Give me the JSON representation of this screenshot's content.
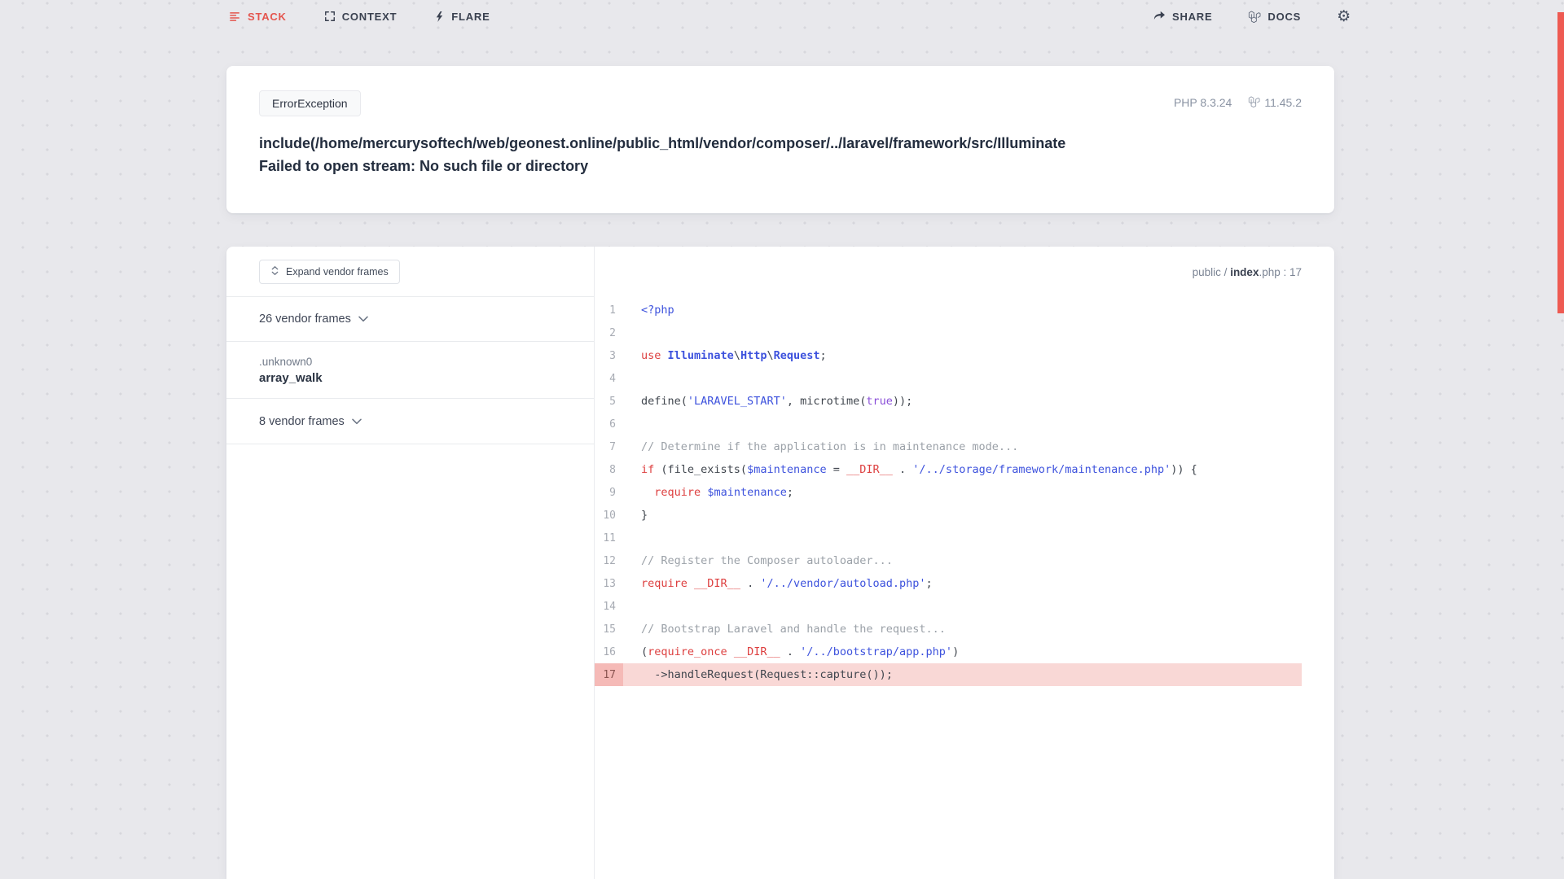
{
  "nav": {
    "tabs": [
      {
        "label": "STACK",
        "active": true
      },
      {
        "label": "CONTEXT",
        "active": false
      },
      {
        "label": "FLARE",
        "active": false
      }
    ],
    "actions": [
      {
        "label": "SHARE"
      },
      {
        "label": "DOCS"
      }
    ]
  },
  "error": {
    "exception_class": "ErrorException",
    "php_version": "PHP 8.3.24",
    "laravel_version": "11.45.2",
    "message_line1": "include(/home/mercurysoftech/web/geonest.online/public_html/vendor/composer/../laravel/framework/src/Illuminate",
    "message_line2": "Failed to open stream: No such file or directory"
  },
  "stack": {
    "expand_button_label": "Expand vendor frames",
    "frames": [
      {
        "type": "group",
        "label": "26 vendor frames"
      },
      {
        "type": "frame",
        "file": ".unknown0",
        "method": "array_walk"
      },
      {
        "type": "group",
        "label": "8 vendor frames"
      }
    ],
    "file_header": {
      "prefix": "public / ",
      "file": "index",
      "suffix": ".php : 17"
    }
  },
  "code": {
    "lines": [
      {
        "n": "1",
        "t": [
          [
            "php",
            "<?php"
          ]
        ]
      },
      {
        "n": "2",
        "t": []
      },
      {
        "n": "3",
        "t": [
          [
            "k",
            "use "
          ],
          [
            "cl",
            "Illuminate"
          ],
          [
            "p",
            "\\"
          ],
          [
            "cl",
            "Http"
          ],
          [
            "p",
            "\\"
          ],
          [
            "cl",
            "Request"
          ],
          [
            "p",
            ";"
          ]
        ]
      },
      {
        "n": "4",
        "t": []
      },
      {
        "n": "5",
        "t": [
          [
            "p",
            "define("
          ],
          [
            "s",
            "'LARAVEL_START'"
          ],
          [
            "p",
            ", microtime("
          ],
          [
            "b",
            "true"
          ],
          [
            "p",
            "));"
          ]
        ]
      },
      {
        "n": "6",
        "t": []
      },
      {
        "n": "7",
        "t": [
          [
            "c",
            "// Determine if the application is in maintenance mode..."
          ]
        ]
      },
      {
        "n": "8",
        "t": [
          [
            "k",
            "if"
          ],
          [
            "p",
            " (file_exists("
          ],
          [
            "v",
            "$maintenance"
          ],
          [
            "p",
            " = "
          ],
          [
            "k",
            "__DIR__"
          ],
          [
            "p",
            " . "
          ],
          [
            "s",
            "'/../storage/framework/maintenance.php'"
          ],
          [
            "p",
            ")) {"
          ]
        ]
      },
      {
        "n": "9",
        "t": [
          [
            "p",
            "  "
          ],
          [
            "k",
            "require"
          ],
          [
            "p",
            " "
          ],
          [
            "v",
            "$maintenance"
          ],
          [
            "p",
            ";"
          ]
        ]
      },
      {
        "n": "10",
        "t": [
          [
            "p",
            "}"
          ]
        ]
      },
      {
        "n": "11",
        "t": []
      },
      {
        "n": "12",
        "t": [
          [
            "c",
            "// Register the Composer autoloader..."
          ]
        ]
      },
      {
        "n": "13",
        "t": [
          [
            "k",
            "require"
          ],
          [
            "p",
            " "
          ],
          [
            "k",
            "__DIR__"
          ],
          [
            "p",
            " . "
          ],
          [
            "s",
            "'/../vendor/autoload.php'"
          ],
          [
            "p",
            ";"
          ]
        ]
      },
      {
        "n": "14",
        "t": []
      },
      {
        "n": "15",
        "t": [
          [
            "c",
            "// Bootstrap Laravel and handle the request..."
          ]
        ]
      },
      {
        "n": "16",
        "t": [
          [
            "p",
            "("
          ],
          [
            "k",
            "require_once"
          ],
          [
            "p",
            " "
          ],
          [
            "k",
            "__DIR__"
          ],
          [
            "p",
            " . "
          ],
          [
            "s",
            "'/../bootstrap/app.php'"
          ],
          [
            "p",
            ")"
          ]
        ]
      },
      {
        "n": "17",
        "hl": true,
        "t": [
          [
            "p",
            "  ->handleRequest(Request::capture());"
          ]
        ]
      }
    ]
  },
  "colors": {
    "accent_red": "#e4564f",
    "code_keyword": "#dd3f3f",
    "code_string": "#3d52dd",
    "code_variable": "#3d52dd",
    "code_class": "#3d52dd",
    "code_bool": "#8a4fd8",
    "code_comment": "#9ba1a8",
    "code_plain": "#40464e",
    "highlight_row_bg": "#f9d8d6",
    "highlight_number_bg": "#f5bab7",
    "scrollbar_red": "#ee5a52"
  }
}
